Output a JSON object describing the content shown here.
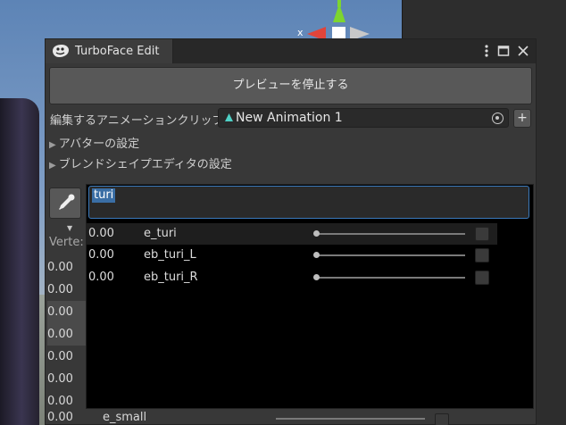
{
  "window": {
    "title": "TurboFace Edit",
    "menu_icon": "more-vertical-icon",
    "maximize_icon": "maximize-icon",
    "close_icon": "close-icon"
  },
  "scene": {
    "gizmo_axis_label": "x"
  },
  "preview_button": "プレビューを停止する",
  "clip": {
    "label": "編集するアニメーションクリップ",
    "value": "New Animation 1",
    "add_label": "+"
  },
  "foldouts": [
    {
      "label": "アバターの設定"
    },
    {
      "label": "ブレンドシェイプエディタの設定"
    }
  ],
  "search": {
    "value": "turi"
  },
  "vertex_label": "Verte:",
  "background_values": [
    "0.00",
    "0.00",
    "0.00",
    "0.00",
    "0.00",
    "0.00",
    "0.00"
  ],
  "results": [
    {
      "value": "0.00",
      "name": "e_turi",
      "level": 0
    },
    {
      "value": "0.00",
      "name": "eb_turi_L",
      "level": 0
    },
    {
      "value": "0.00",
      "name": "eb_turi_R",
      "level": 0
    }
  ],
  "bottom_row": {
    "value": "0.00",
    "name": "e_small",
    "level": 0
  },
  "colors": {
    "accent": "#3a79bb",
    "panel": "#383838",
    "dropdown": "#000000"
  }
}
